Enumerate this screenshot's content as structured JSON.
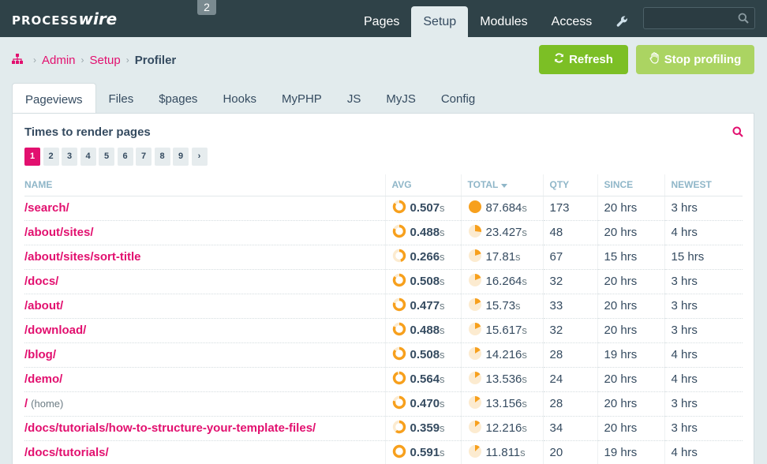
{
  "masthead": {
    "logo_a": "PROCESS",
    "logo_b": "wire",
    "badge": "2",
    "nav": [
      {
        "label": "Pages",
        "active": false
      },
      {
        "label": "Setup",
        "active": true
      },
      {
        "label": "Modules",
        "active": false
      },
      {
        "label": "Access",
        "active": false
      }
    ],
    "search_placeholder": "",
    "icons": {
      "wrench": "wrench-icon",
      "search": "search-icon"
    }
  },
  "breadcrumb": {
    "home_icon": "sitemap-icon",
    "items": [
      "Admin",
      "Setup"
    ],
    "separator": "›",
    "current": "Profiler"
  },
  "actions": {
    "refresh_label": "Refresh",
    "stop_label": "Stop profiling",
    "refresh_color": "#7cbf25",
    "stop_color": "#abd462"
  },
  "tabs": [
    "Pageviews",
    "Files",
    "$pages",
    "Hooks",
    "MyPHP",
    "JS",
    "MyJS",
    "Config"
  ],
  "panel": {
    "title": "Times to render pages",
    "pager": [
      "1",
      "2",
      "3",
      "4",
      "5",
      "6",
      "7",
      "8",
      "9",
      "›"
    ],
    "columns": [
      "NAME",
      "AVG",
      "TOTAL",
      "QTY",
      "SINCE",
      "NEWEST"
    ],
    "unit": "s",
    "rows": [
      {
        "name": "/search/",
        "note": "",
        "avg": "0.507",
        "avg_pie": 0.85,
        "total": "87.684",
        "total_pie": 1.0,
        "qty": "173",
        "since": "20 hrs",
        "newest": "3 hrs"
      },
      {
        "name": "/about/sites/",
        "note": "",
        "avg": "0.488",
        "avg_pie": 0.82,
        "total": "23.427",
        "total_pie": 0.27,
        "qty": "48",
        "since": "20 hrs",
        "newest": "4 hrs"
      },
      {
        "name": "/about/sites/sort-title",
        "note": "",
        "avg": "0.266",
        "avg_pie": 0.45,
        "total": "17.81",
        "total_pie": 0.2,
        "qty": "67",
        "since": "15 hrs",
        "newest": "15 hrs"
      },
      {
        "name": "/docs/",
        "note": "",
        "avg": "0.508",
        "avg_pie": 0.85,
        "total": "16.264",
        "total_pie": 0.19,
        "qty": "32",
        "since": "20 hrs",
        "newest": "3 hrs"
      },
      {
        "name": "/about/",
        "note": "",
        "avg": "0.477",
        "avg_pie": 0.8,
        "total": "15.73",
        "total_pie": 0.18,
        "qty": "33",
        "since": "20 hrs",
        "newest": "3 hrs"
      },
      {
        "name": "/download/",
        "note": "",
        "avg": "0.488",
        "avg_pie": 0.82,
        "total": "15.617",
        "total_pie": 0.18,
        "qty": "32",
        "since": "20 hrs",
        "newest": "3 hrs"
      },
      {
        "name": "/blog/",
        "note": "",
        "avg": "0.508",
        "avg_pie": 0.85,
        "total": "14.216",
        "total_pie": 0.16,
        "qty": "28",
        "since": "19 hrs",
        "newest": "4 hrs"
      },
      {
        "name": "/demo/",
        "note": "",
        "avg": "0.564",
        "avg_pie": 0.95,
        "total": "13.536",
        "total_pie": 0.15,
        "qty": "24",
        "since": "20 hrs",
        "newest": "4 hrs"
      },
      {
        "name": "/",
        "note": "(home)",
        "avg": "0.470",
        "avg_pie": 0.79,
        "total": "13.156",
        "total_pie": 0.15,
        "qty": "28",
        "since": "20 hrs",
        "newest": "3 hrs"
      },
      {
        "name": "/docs/tutorials/how-to-structure-your-template-files/",
        "note": "",
        "avg": "0.359",
        "avg_pie": 0.6,
        "total": "12.216",
        "total_pie": 0.14,
        "qty": "34",
        "since": "20 hrs",
        "newest": "3 hrs"
      },
      {
        "name": "/docs/tutorials/",
        "note": "",
        "avg": "0.591",
        "avg_pie": 1.0,
        "total": "11.811",
        "total_pie": 0.13,
        "qty": "20",
        "since": "19 hrs",
        "newest": "4 hrs"
      }
    ]
  },
  "colors": {
    "accent": "#e2106f",
    "masthead": "#2f4248",
    "pie": "#f7a01d",
    "pie_bg": "#fcebd0"
  }
}
